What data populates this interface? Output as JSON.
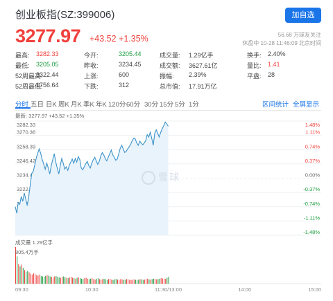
{
  "header": {
    "title": "创业板指(SZ:399006)",
    "add_button": "加自选",
    "price": "3277.97",
    "change": "+43.52 +1.35%",
    "followers": "56.68 万球友关注",
    "status": "休盘中 10-28 11:46:09 北京时间"
  },
  "stats": [
    [
      {
        "label": "最高:",
        "value": "3282.33",
        "color": "red"
      },
      {
        "label": "今开:",
        "value": "3205.44",
        "color": "green"
      },
      {
        "label": "成交量:",
        "value": "1.29亿手",
        "color": ""
      },
      {
        "label": "换手:",
        "value": "2.40%",
        "color": ""
      }
    ],
    [
      {
        "label": "最低:",
        "value": "3205.05",
        "color": "green"
      },
      {
        "label": "昨收:",
        "value": "3234.45",
        "color": ""
      },
      {
        "label": "成交额:",
        "value": "3627.61亿",
        "color": ""
      },
      {
        "label": "量比:",
        "value": "1.41",
        "color": "red"
      }
    ],
    [
      {
        "label": "52周最高:",
        "value": "3322.44",
        "color": ""
      },
      {
        "label": "上涨:",
        "value": "600",
        "color": ""
      },
      {
        "label": "振幅:",
        "value": "2.39%",
        "color": ""
      },
      {
        "label": "平盘:",
        "value": "28",
        "color": ""
      }
    ],
    [
      {
        "label": "52周最低:",
        "value": "1756.64",
        "color": ""
      },
      {
        "label": "下跌:",
        "value": "312",
        "color": ""
      },
      {
        "label": "总市值:",
        "value": "17.91万亿",
        "color": ""
      }
    ]
  ],
  "tabs": [
    "分时",
    "五日",
    "日K",
    "周K",
    "月K",
    "季K",
    "年K",
    "120分",
    "60分",
    "30分",
    "15分",
    "5分",
    "1分"
  ],
  "tab_links": [
    "区间统计",
    "全屏显示"
  ],
  "chart_info": "最新: 3277.97 +43.52 +1.35%",
  "watermark": "雪球",
  "vol_label": "成交量 1.29亿手",
  "vol_max": "805.4万手",
  "colors": {
    "up": "#f0403c",
    "down": "#1a9b3c",
    "accent": "#1a75e8",
    "line": "#3c93c8"
  },
  "chart_data": {
    "type": "line",
    "title": "",
    "xlabel": "",
    "ylabel": "",
    "y_ticks": [
      "3282.33",
      "3270.36",
      "3258.39",
      "3246.42",
      "3234.45",
      "3222.48",
      "3210.51",
      "3198.54",
      "3186.57"
    ],
    "pct_ticks": [
      "1.48%",
      "1.11%",
      "0.74%",
      "0.37%",
      "0.00%",
      "-0.37%",
      "-0.74%",
      "-1.11%",
      "-1.48%"
    ],
    "x_ticks": [
      "09:30",
      "10:30",
      "11:30/13:00",
      "14:00",
      "15:00"
    ],
    "ylim": [
      3186.57,
      3282.33
    ],
    "prev_close": 3234.45,
    "grid": true,
    "x": [
      0,
      1,
      2,
      3,
      4,
      5,
      6,
      7,
      8,
      9,
      10,
      11,
      12,
      13,
      14,
      15,
      16,
      17,
      18,
      19,
      20,
      21,
      22,
      23,
      24,
      25,
      26,
      27,
      28,
      29,
      30,
      31,
      32,
      33,
      34,
      35,
      36,
      37,
      38,
      39,
      40,
      41,
      42,
      43,
      44,
      45,
      46,
      47,
      48,
      49,
      50,
      51,
      52,
      53,
      54,
      55,
      56,
      57,
      58,
      59,
      60,
      61,
      62,
      63,
      64,
      65,
      66,
      67,
      68,
      69,
      70,
      71,
      72,
      73,
      74,
      75,
      76,
      77,
      78,
      79,
      80,
      81,
      82,
      83,
      84,
      85,
      86,
      87,
      88,
      89,
      90,
      91,
      92,
      93,
      94,
      95,
      96,
      97,
      98,
      99,
      100,
      101,
      102,
      103,
      104,
      105,
      106,
      107,
      108,
      109,
      110,
      111,
      112,
      113,
      114,
      115,
      116,
      117,
      118,
      119,
      120,
      121,
      122,
      123,
      124,
      125,
      126,
      127,
      128,
      129,
      130,
      131,
      132,
      133,
      134,
      135
    ],
    "values": [
      3210.5,
      3205.1,
      3214.0,
      3212.5,
      3219.0,
      3215.0,
      3222.0,
      3217.0,
      3211.5,
      3219.5,
      3229.0,
      3238.5,
      3240.0,
      3245.5,
      3251.5,
      3255.5,
      3259.0,
      3255.0,
      3250.0,
      3246.0,
      3242.0,
      3247.0,
      3243.0,
      3238.0,
      3245.0,
      3250.0,
      3255.0,
      3248.0,
      3243.0,
      3238.0,
      3245.0,
      3251.0,
      3247.0,
      3242.0,
      3244.0,
      3241.0,
      3245.0,
      3248.0,
      3250.5,
      3247.0,
      3251.0,
      3248.0,
      3252.5,
      3250.0,
      3243.0,
      3241.5,
      3244.0,
      3246.5,
      3248.5,
      3245.0,
      3243.0,
      3247.0,
      3250.0,
      3252.0,
      3249.0,
      3246.0,
      3248.5,
      3253.0,
      3256.0,
      3254.0,
      3251.0,
      3249.0,
      3252.0,
      3255.0,
      3258.0,
      3254.0,
      3252.0,
      3249.5,
      3250.5,
      3255.0,
      3259.5,
      3262.0,
      3259.0,
      3256.0,
      3257.0,
      3259.0,
      3261.0,
      3263.0,
      3266.0,
      3268.0,
      3267.5,
      3264.0,
      3262.0,
      3265.5,
      3264.0,
      3262.5,
      3264.0,
      3266.0,
      3271.0,
      3269.0,
      3273.0,
      3268.0,
      3262.0,
      3272.0,
      3275.0,
      3272.0,
      3269.0,
      3273.0,
      3276.0,
      3278.5,
      3281.5,
      3280.0,
      3277.97
    ]
  },
  "volume_data": [
    805.4,
    600,
    430,
    380,
    420,
    350,
    300,
    260,
    280,
    250,
    220,
    200,
    230,
    210,
    190,
    180,
    200,
    170,
    160,
    150,
    170,
    190,
    180,
    160,
    150,
    140,
    160,
    170,
    150,
    140,
    130,
    150,
    160,
    140,
    130,
    120,
    140,
    150,
    130,
    120,
    110,
    130,
    140,
    120,
    110,
    100,
    120,
    130,
    110,
    100,
    110,
    120,
    100,
    90,
    110,
    120,
    100,
    90,
    100,
    110,
    95,
    85,
    100,
    110,
    90,
    80,
    95,
    105,
    90,
    85,
    100,
    95,
    85,
    90,
    100,
    95,
    85,
    80,
    90,
    95,
    85,
    80,
    90,
    100,
    95,
    85,
    90,
    100,
    110,
    95,
    90,
    100,
    110,
    105,
    95,
    100,
    110,
    120,
    115,
    110,
    105,
    130,
    150
  ]
}
